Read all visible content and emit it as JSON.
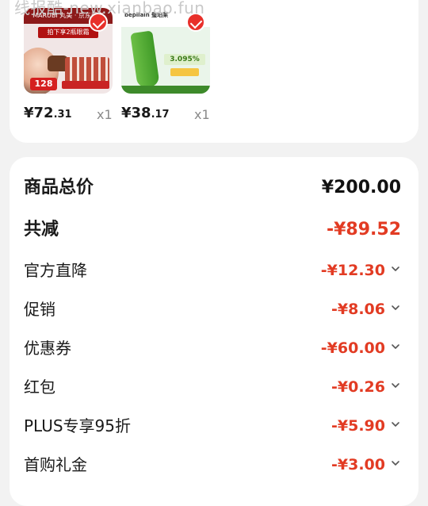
{
  "watermark": "线报酷-new.xianbao.fun",
  "products": [
    {
      "image_texts": {
        "brand": "MARUBI 丸美 · 京东超市",
        "banner": "拍下享2瓶眼霜",
        "price_tag": "128"
      },
      "price_yuan": "¥72",
      "price_cents": ".31",
      "quantity": "x1",
      "selected": true
    },
    {
      "image_texts": {
        "brand": "bepilain 璧珀莱",
        "percent": "3.095%"
      },
      "price_yuan": "¥38",
      "price_cents": ".17",
      "quantity": "x1",
      "selected": true
    }
  ],
  "summary": {
    "total": {
      "label": "商品总价",
      "value": "¥200.00"
    },
    "reduction": {
      "label": "共减",
      "value": "-¥89.52"
    },
    "discounts": [
      {
        "label": "官方直降",
        "value": "-¥12.30"
      },
      {
        "label": "促销",
        "value": "-¥8.06"
      },
      {
        "label": "优惠券",
        "value": "-¥60.00"
      },
      {
        "label": "红包",
        "value": "-¥0.26"
      },
      {
        "label": "PLUS专享95折",
        "value": "-¥5.90"
      },
      {
        "label": "首购礼金",
        "value": "-¥3.00"
      }
    ]
  },
  "colors": {
    "accent_red": "#e23b23",
    "check_red": "#e8302a",
    "page_bg": "#f2f2f2"
  }
}
